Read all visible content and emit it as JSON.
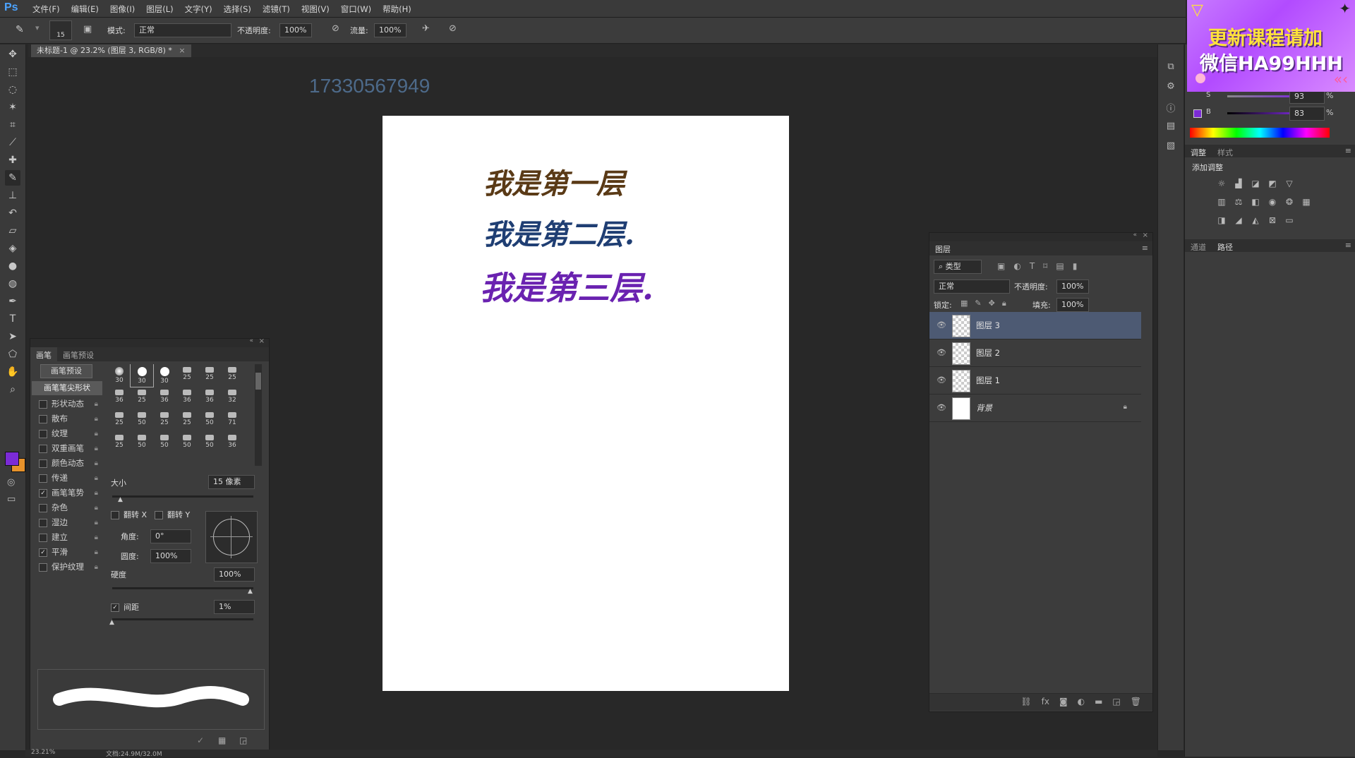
{
  "app": {
    "logo": "Ps"
  },
  "menu": [
    "文件(F)",
    "编辑(E)",
    "图像(I)",
    "图层(L)",
    "文字(Y)",
    "选择(S)",
    "滤镜(T)",
    "视图(V)",
    "窗口(W)",
    "帮助(H)"
  ],
  "options": {
    "brush_size": "15",
    "mode_label": "模式:",
    "mode_value": "正常",
    "opacity_label": "不透明度:",
    "opacity_value": "100%",
    "flow_label": "流量:",
    "flow_value": "100%"
  },
  "document_tab": "未标题-1 @ 23.2% (图层 3, RGB/8) *",
  "canvas": {
    "watermark_number": "17330567949",
    "lines": [
      {
        "text": "我是第一层",
        "color": "#5a3a16"
      },
      {
        "text": "我是第二层.",
        "color": "#1f3e73"
      },
      {
        "text": "我是第三层.",
        "color": "#6a22b0"
      }
    ]
  },
  "brush_panel": {
    "tabs": [
      "画笔",
      "画笔预设"
    ],
    "preset_button": "画笔预设",
    "tip_shape": "画笔笔尖形状",
    "options": [
      {
        "label": "形状动态",
        "checked": false
      },
      {
        "label": "散布",
        "checked": false
      },
      {
        "label": "纹理",
        "checked": false
      },
      {
        "label": "双重画笔",
        "checked": false
      },
      {
        "label": "颜色动态",
        "checked": false
      },
      {
        "label": "传递",
        "checked": false
      },
      {
        "label": "画笔笔势",
        "checked": true
      },
      {
        "label": "杂色",
        "checked": false
      },
      {
        "label": "湿边",
        "checked": false
      },
      {
        "label": "建立",
        "checked": false
      },
      {
        "label": "平滑",
        "checked": true
      },
      {
        "label": "保护纹理",
        "checked": false
      }
    ],
    "tip_sizes": [
      "30",
      "30",
      "30",
      "25",
      "25",
      "25",
      "36",
      "25",
      "36",
      "36",
      "36",
      "32",
      "25",
      "50",
      "25",
      "25",
      "50",
      "71",
      "25",
      "50",
      "50",
      "50",
      "50",
      "36"
    ],
    "size_label": "大小",
    "size_value": "15 像素",
    "flip_x": "翻转 X",
    "flip_y": "翻转 Y",
    "angle_label": "角度:",
    "angle_value": "0°",
    "roundness_label": "圆度:",
    "roundness_value": "100%",
    "hardness_label": "硬度",
    "hardness_value": "100%",
    "spacing_label": "间距",
    "spacing_value": "1%",
    "spacing_checked": true
  },
  "layers_panel": {
    "title": "图层",
    "filter_label": "类型",
    "blend_mode": "正常",
    "opacity_label": "不透明度:",
    "opacity_value": "100%",
    "lock_label": "锁定:",
    "fill_label": "填充:",
    "fill_value": "100%",
    "layers": [
      {
        "name": "图层 3",
        "selected": true
      },
      {
        "name": "图层 2",
        "selected": false
      },
      {
        "name": "图层 1",
        "selected": false
      },
      {
        "name": "背景",
        "selected": false
      }
    ]
  },
  "right_panel": {
    "promo_line1": "更新课程请加",
    "promo_line2": "微信HA99HHH",
    "s_label": "S",
    "s_value": "93",
    "b_label": "B",
    "b_value": "83",
    "percent": "%",
    "adjust_tabs": [
      "调整",
      "样式"
    ],
    "adjust_title": "添加调整",
    "bottom_tabs": [
      "通道",
      "路径"
    ]
  },
  "status": {
    "zoom": "23.21%",
    "doc": "文档:24.9M/32.0M"
  },
  "colors": {
    "foreground": "#7b2bd6",
    "background": "#e7922b"
  }
}
